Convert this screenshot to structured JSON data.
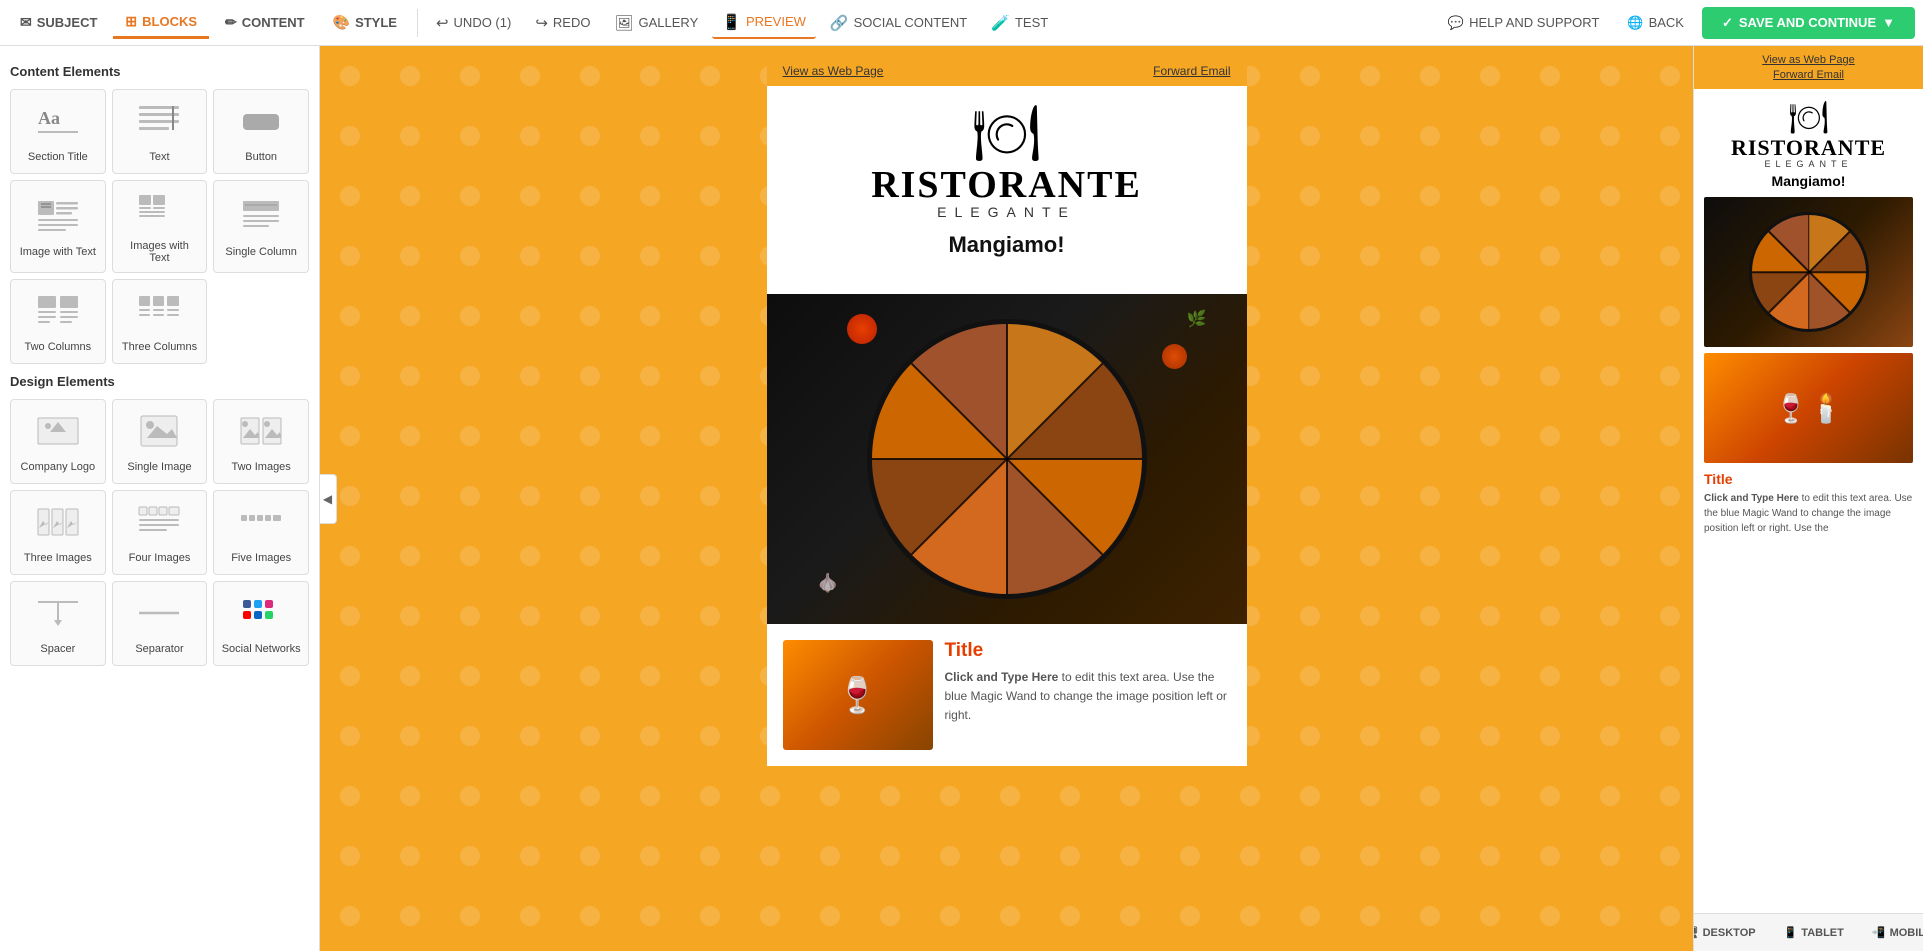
{
  "toolbar": {
    "tabs": [
      {
        "id": "subject",
        "label": "SUBJECT",
        "icon": "✉",
        "active": false
      },
      {
        "id": "blocks",
        "label": "BLOCKS",
        "icon": "⊞",
        "active": true
      },
      {
        "id": "content",
        "label": "CONTENT",
        "icon": "✏",
        "active": false
      },
      {
        "id": "style",
        "label": "STYLE",
        "icon": "🎨",
        "active": false
      }
    ],
    "actions": [
      {
        "id": "undo",
        "label": "UNDO (1)",
        "icon": "↩"
      },
      {
        "id": "redo",
        "label": "REDO",
        "icon": "↪"
      },
      {
        "id": "gallery",
        "label": "GALLERY",
        "icon": "🖼"
      },
      {
        "id": "preview",
        "label": "PREVIEW",
        "icon": "📱"
      },
      {
        "id": "social",
        "label": "SOCIAL CONTENT",
        "icon": "🔗"
      },
      {
        "id": "test",
        "label": "TEST",
        "icon": "🧪"
      }
    ],
    "right_actions": [
      {
        "id": "help",
        "label": "HELP AND SUPPORT",
        "icon": "💬"
      },
      {
        "id": "back",
        "label": "BACK",
        "icon": "🌐"
      }
    ],
    "save_label": "SAVE AND CONTINUE"
  },
  "left_panel": {
    "content_heading": "Content Elements",
    "design_heading": "Design Elements",
    "content_blocks": [
      {
        "id": "section-title",
        "label": "Section Title",
        "icon": "Aa"
      },
      {
        "id": "text",
        "label": "Text",
        "icon": "text"
      },
      {
        "id": "button",
        "label": "Button",
        "icon": "btn"
      },
      {
        "id": "image-with-text",
        "label": "Image with Text",
        "icon": "img-text"
      },
      {
        "id": "images-with-text",
        "label": "Images with Text",
        "icon": "imgs-text"
      },
      {
        "id": "single-column",
        "label": "Single Column",
        "icon": "single"
      },
      {
        "id": "two-columns",
        "label": "Two Columns",
        "icon": "two-col"
      },
      {
        "id": "three-columns",
        "label": "Three Columns",
        "icon": "three-col"
      }
    ],
    "design_blocks": [
      {
        "id": "company-logo",
        "label": "Company Logo",
        "icon": "logo"
      },
      {
        "id": "single-image",
        "label": "Single Image",
        "icon": "single-img"
      },
      {
        "id": "two-images",
        "label": "Two Images",
        "icon": "two-img"
      },
      {
        "id": "three-images",
        "label": "Three Images",
        "icon": "three-img"
      },
      {
        "id": "four-images",
        "label": "Four Images",
        "icon": "four-img"
      },
      {
        "id": "five-images",
        "label": "Five Images",
        "icon": "five-img"
      },
      {
        "id": "spacer",
        "label": "Spacer",
        "icon": "spacer"
      },
      {
        "id": "separator",
        "label": "Separator",
        "icon": "sep"
      },
      {
        "id": "social-networks",
        "label": "Social Networks",
        "icon": "social"
      }
    ]
  },
  "email_preview": {
    "view_as_web": "View as Web Page",
    "forward_email": "Forward Email",
    "restaurant_name": "RISTORANTE",
    "restaurant_subtitle": "ELEGANTE",
    "tagline": "Mangiamo!",
    "content_title": "Title",
    "content_body": "Click and Type Here to edit this text area. Use the blue Magic Wand to change the image position left or right."
  },
  "right_preview": {
    "view_as_web": "View as Web Page",
    "forward_email": "Forward Email",
    "restaurant_name": "RISTORANTE",
    "restaurant_subtitle": "ELEGANTE",
    "tagline": "Mangiamo!",
    "content_title": "Title",
    "content_body": "Click and Type Here to edit this text area. Use the blue Magic Wand to change the image position left or right. Use the"
  },
  "device_bar": {
    "desktop_label": "DESKTOP",
    "tablet_label": "TABLET",
    "mobile_label": "MOBILE"
  }
}
